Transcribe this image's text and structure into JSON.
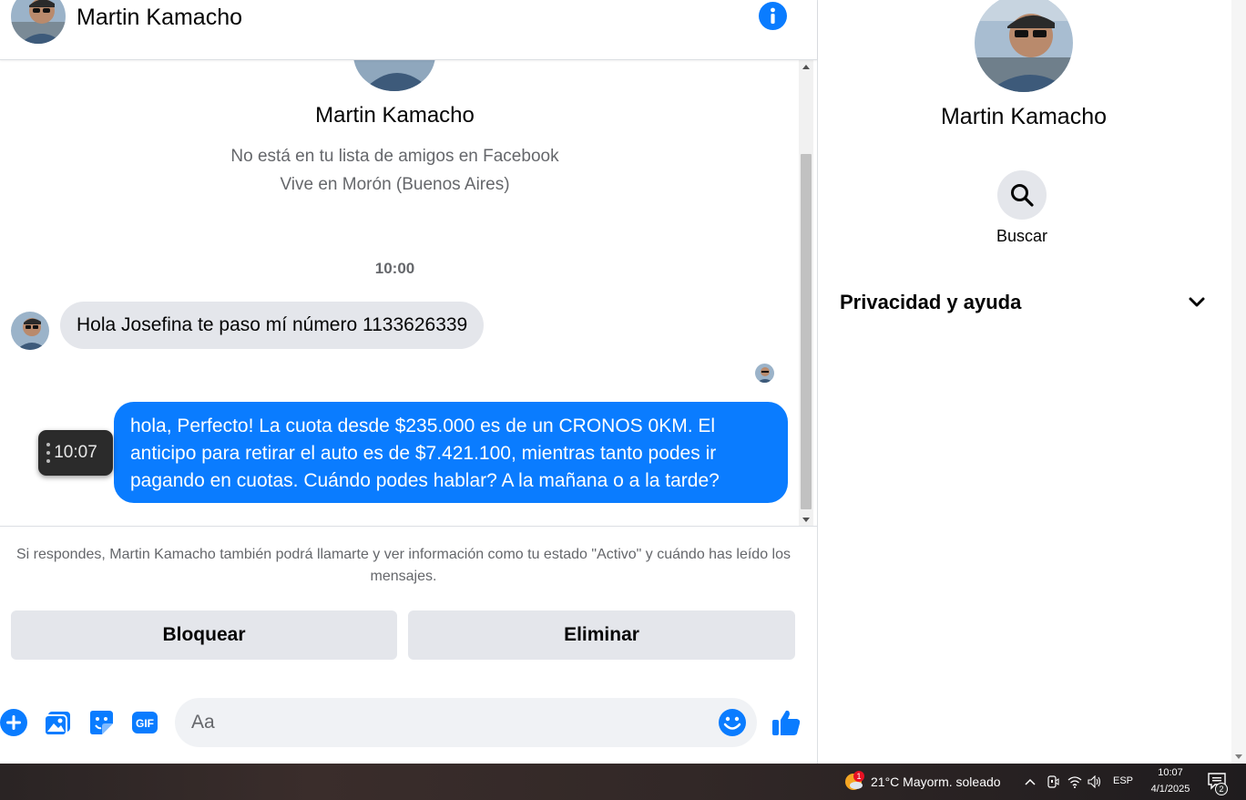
{
  "header": {
    "contact_name": "Martin Kamacho"
  },
  "profile_intro": {
    "name": "Martin Kamacho",
    "not_friends_text": "No está en tu lista de amigos en Facebook",
    "location_text": "Vive en Morón (Buenos Aires)"
  },
  "conversation": {
    "timestamp": "10:00",
    "incoming_message": "Hola Josefina te paso mí número 1133626339",
    "outgoing_message": "hola, Perfecto! La cuota desde $235.000 es de un CRONOS 0KM. El anticipo para retirar el auto es de $7.421.100, mientras tanto podes ir pagando en cuotas. Cuándo podes hablar? A la mañana o a la tarde?",
    "hover_time": "10:07"
  },
  "request_notice": "Si respondes, Martin Kamacho también podrá llamarte y ver información como tu estado \"Activo\" y cuándo has leído los mensajes.",
  "actions": {
    "block_label": "Bloquear",
    "delete_label": "Eliminar"
  },
  "composer": {
    "placeholder": "Aa",
    "icons": [
      "plus-icon",
      "gallery-icon",
      "sticker-icon",
      "gif-icon",
      "emoji-icon",
      "thumbs-up-icon"
    ]
  },
  "side_panel": {
    "name": "Martin Kamacho",
    "search_label": "Buscar",
    "privacy_label": "Privacidad y ayuda"
  },
  "taskbar": {
    "weather_badge": "1",
    "weather_text": "21°C  Mayorm. soleado",
    "language": "ESP",
    "time": "10:07",
    "date": "4/1/2025",
    "notification_count": "2"
  },
  "colors": {
    "accent": "#0a7cff",
    "bubble_gray": "#e4e6eb",
    "secondary_text": "#65676b"
  }
}
